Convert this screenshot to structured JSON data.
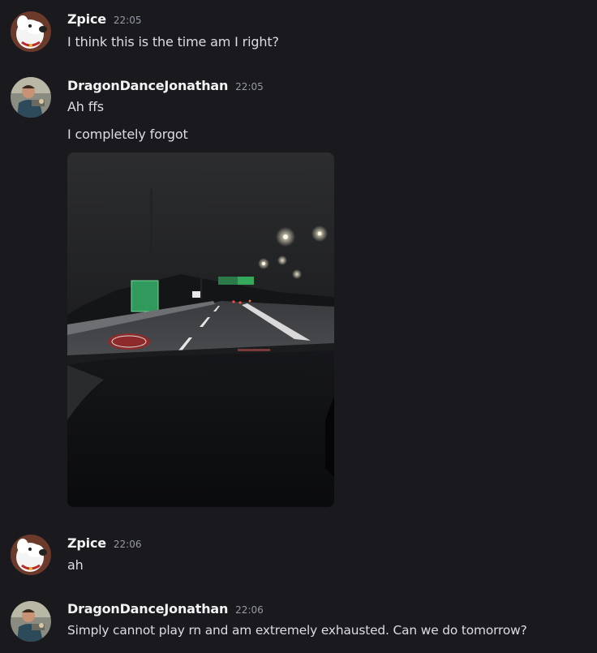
{
  "messages": [
    {
      "author": "Zpice",
      "time": "22:05",
      "avatar_icon": "white-cartoon-dog-avatar",
      "lines": [
        "I think this is the time am I right?"
      ]
    },
    {
      "author": "DragonDanceJonathan",
      "time": "22:05",
      "avatar_icon": "person-photo-avatar",
      "lines": [
        "Ah ffs",
        "I completely forgot"
      ],
      "attachment": "night-highway-photo"
    },
    {
      "author": "Zpice",
      "time": "22:06",
      "avatar_icon": "white-cartoon-dog-avatar",
      "lines": [
        "ah"
      ]
    },
    {
      "author": "DragonDanceJonathan",
      "time": "22:06",
      "avatar_icon": "person-photo-avatar",
      "lines": [
        "Simply cannot play rn and am extremely exhausted. Can we do tomorrow?"
      ]
    }
  ],
  "colors": {
    "background": "#1a1a1e",
    "username": "#f2f3f5",
    "message_text": "#dbdee1",
    "timestamp": "#949ba4"
  }
}
